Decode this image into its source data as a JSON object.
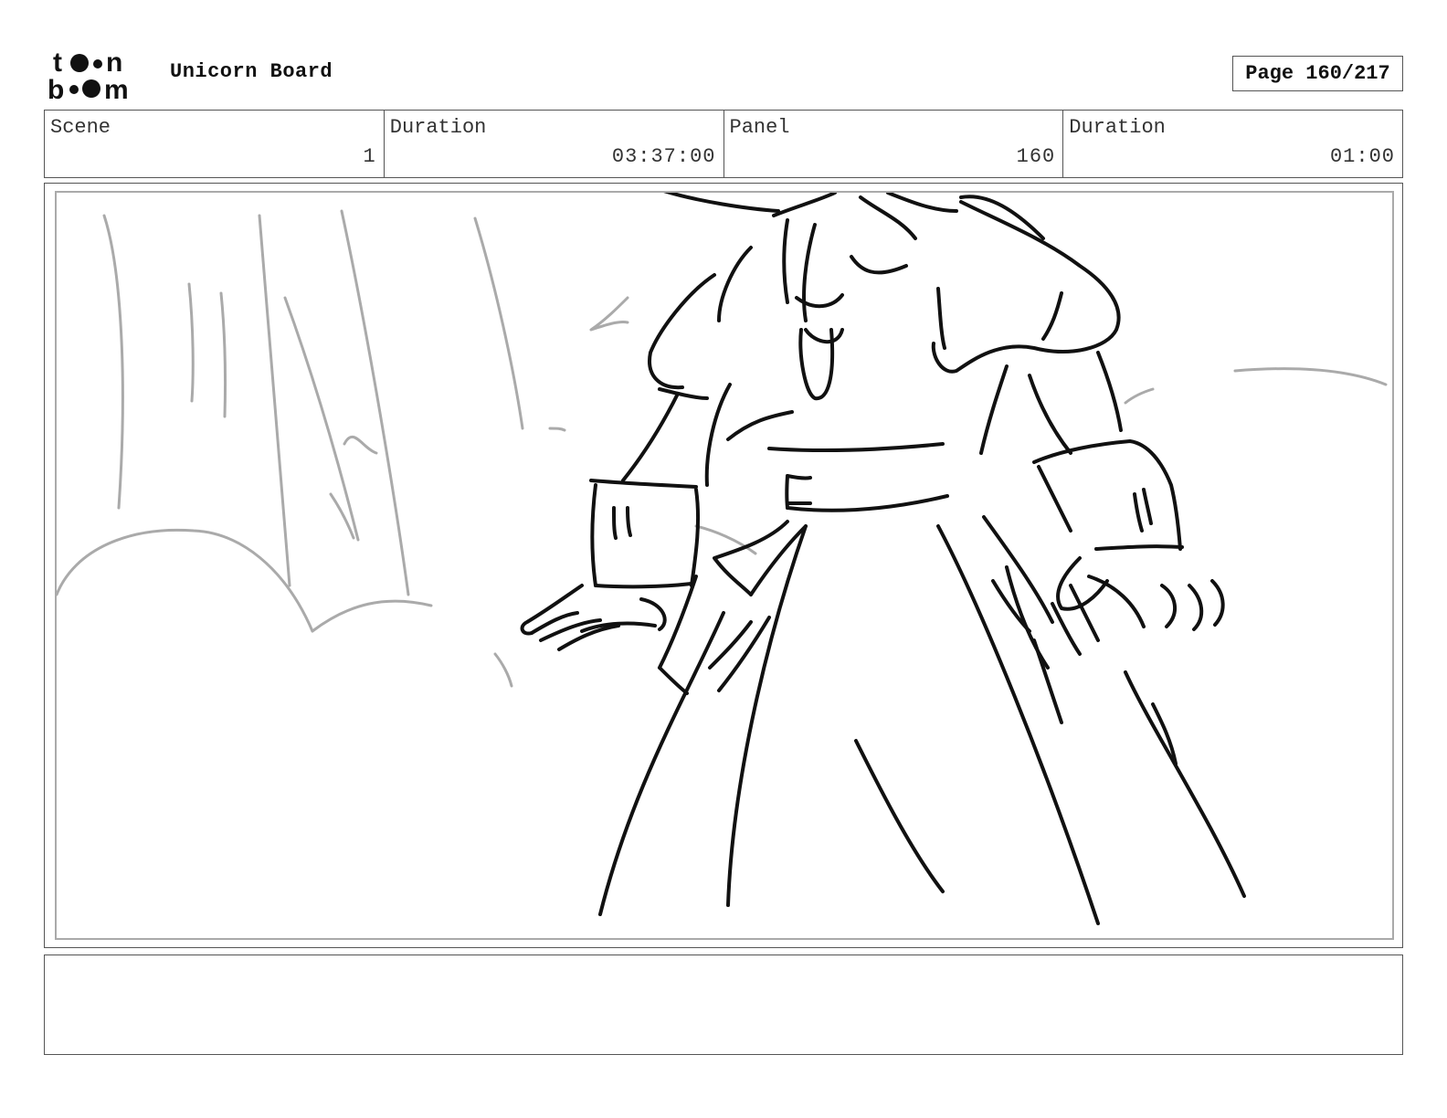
{
  "header": {
    "logo_icon": "toonboom-logo",
    "board_title": "Unicorn Board",
    "page_label": "Page 160/217"
  },
  "info": {
    "scene_label": "Scene",
    "scene_value": "1",
    "scene_duration_label": "Duration",
    "scene_duration_value": "03:37:00",
    "panel_label": "Panel",
    "panel_value": "160",
    "panel_duration_label": "Duration",
    "panel_duration_value": "01:00"
  },
  "notes": {
    "text": ""
  }
}
